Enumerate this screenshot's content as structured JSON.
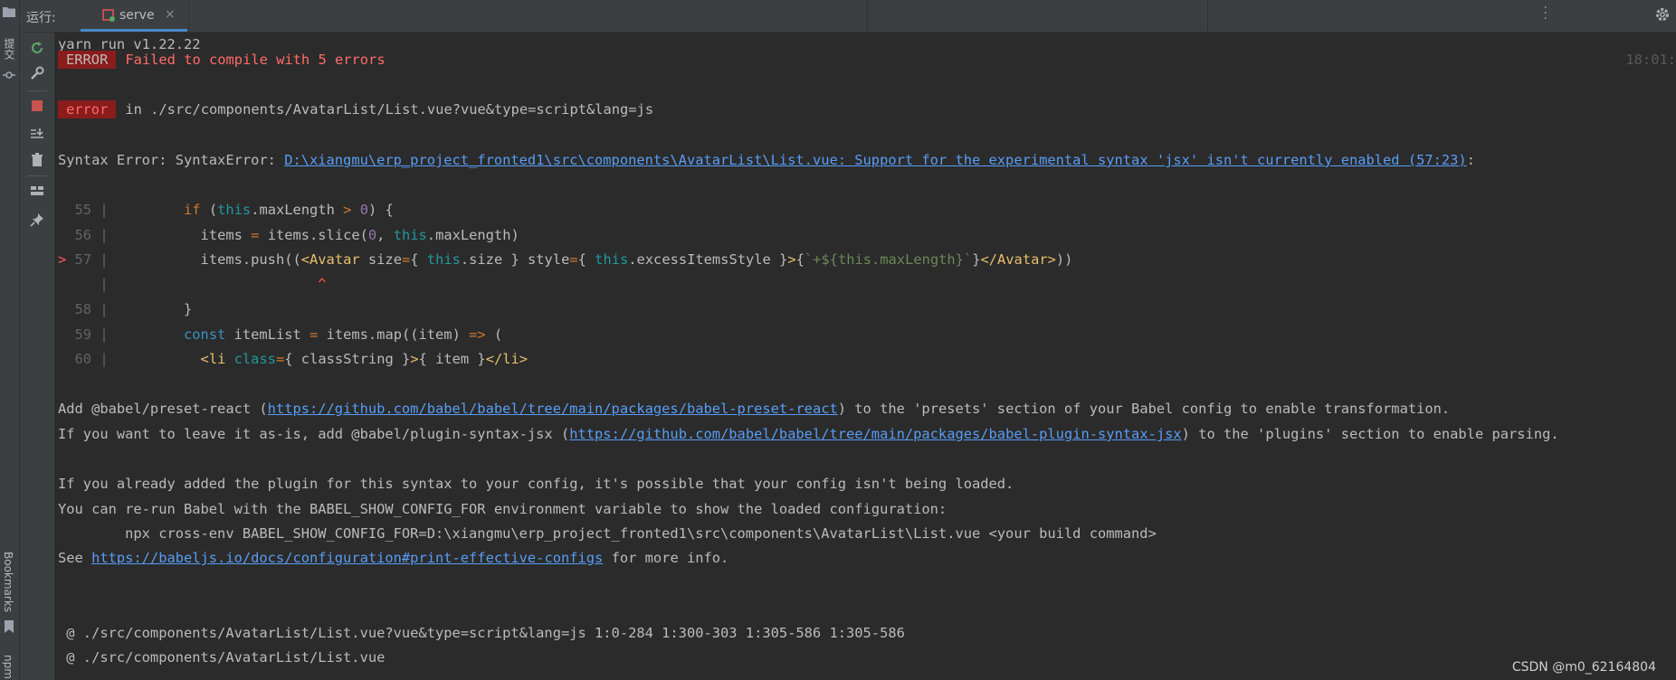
{
  "window": {
    "run_label": "运行:",
    "tab_label": "serve",
    "tab_close": "×",
    "left_labels": {
      "commit": "提交",
      "bookmarks": "Bookmarks",
      "npm": "npm"
    }
  },
  "console": {
    "timestamp": "18:01:",
    "header": "yarn run v1.22.22",
    "error_badge": "ERROR",
    "error_message": "Failed to compile with 5 errors",
    "error_lower_badge": "error",
    "error_location": "in ./src/components/AvatarList/List.vue?vue&type=script&lang=js",
    "syntax_prefix": "Syntax Error: SyntaxError: ",
    "syntax_link": "D:\\xiangmu\\erp_project_fronted1\\src\\components\\AvatarList\\List.vue: Support for the experimental syntax 'jsx' isn't currently enabled (57:23)",
    "syntax_suffix": ":",
    "code": {
      "l55_no": "  55 | ",
      "l56_no": "  56 | ",
      "l57_marker": "> ",
      "l57_no": "57 | ",
      "caret_no": "     | ",
      "caret": "^",
      "l58_no": "  58 | ",
      "l59_no": "  59 | ",
      "l60_no": "  60 | "
    },
    "preset_prefix": "Add @babel/preset-react (",
    "preset_link": "https://github.com/babel/babel/tree/main/packages/babel-preset-react",
    "preset_suffix": ") to the 'presets' section of your Babel config to enable transformation.",
    "plugin_prefix": "If you want to leave it as-is, add @babel/plugin-syntax-jsx (",
    "plugin_link": "https://github.com/babel/babel/tree/main/packages/babel-plugin-syntax-jsx",
    "plugin_suffix": ") to the 'plugins' section to enable parsing.",
    "already_added": "If you already added the plugin for this syntax to your config, it's possible that your config isn't being loaded.",
    "rerun": "You can re-run Babel with the BABEL_SHOW_CONFIG_FOR environment variable to show the loaded configuration:",
    "npx_cmd": "        npx cross-env BABEL_SHOW_CONFIG_FOR=D:\\xiangmu\\erp_project_fronted1\\src\\components\\AvatarList\\List.vue <your build command>",
    "see_prefix": "See ",
    "see_link": "https://babeljs.io/docs/configuration#print-effective-configs",
    "see_suffix": " for more info.",
    "at_line1": " @ ./src/components/AvatarList/List.vue?vue&type=script&lang=js 1:0-284 1:300-303 1:305-586 1:305-586",
    "at_line2": " @ ./src/components/AvatarList/List.vue"
  },
  "watermark": "CSDN @m0_62164804",
  "colors": {
    "background": "#2b2b2b",
    "error_badge": "#8a1c1c",
    "error_text": "#ff6b68",
    "link": "#589df6",
    "tab_underline": "#4a88c7"
  },
  "icons": [
    "folder-icon",
    "rerun-icon",
    "wrench-icon",
    "stop-icon",
    "scroll-to-end-icon",
    "trash-icon",
    "layout-icon",
    "pin-icon",
    "gear-icon",
    "vue-icon",
    "close-icon"
  ]
}
